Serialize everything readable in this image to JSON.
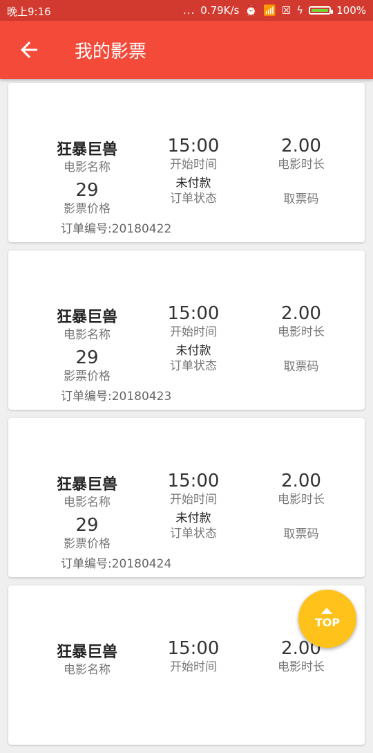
{
  "status_bar": {
    "time": "晚上9:16",
    "dots": "...",
    "speed": "0.79K/s",
    "battery": "100%"
  },
  "app_bar": {
    "title": "我的影票"
  },
  "tickets": [
    {
      "movie_name": "狂暴巨兽",
      "movie_name_label": "电影名称",
      "start_time": "15:00",
      "start_time_label": "开始时间",
      "duration": "2.00",
      "duration_label": "电影时长",
      "price": "29",
      "price_label": "影票价格",
      "order_status": "未付款",
      "order_status_label": "订单状态",
      "ticket_code_label": "取票码",
      "order_number": "订单编号:20180422"
    },
    {
      "movie_name": "狂暴巨兽",
      "movie_name_label": "电影名称",
      "start_time": "15:00",
      "start_time_label": "开始时间",
      "duration": "2.00",
      "duration_label": "电影时长",
      "price": "29",
      "price_label": "影票价格",
      "order_status": "未付款",
      "order_status_label": "订单状态",
      "ticket_code_label": "取票码",
      "order_number": "订单编号:20180423"
    },
    {
      "movie_name": "狂暴巨兽",
      "movie_name_label": "电影名称",
      "start_time": "15:00",
      "start_time_label": "开始时间",
      "duration": "2.00",
      "duration_label": "电影时长",
      "price": "29",
      "price_label": "影票价格",
      "order_status": "未付款",
      "order_status_label": "订单状态",
      "ticket_code_label": "取票码",
      "order_number": "订单编号:20180424"
    },
    {
      "movie_name": "狂暴巨兽",
      "movie_name_label": "电影名称",
      "start_time": "15:00",
      "start_time_label": "开始时间",
      "duration": "2.00",
      "duration_label": "电影时长"
    }
  ],
  "top_button": {
    "label": "TOP"
  },
  "colors": {
    "app_bar": "#f44a3a",
    "status_bar": "#d23a2f",
    "top_button": "#ffc21a"
  }
}
